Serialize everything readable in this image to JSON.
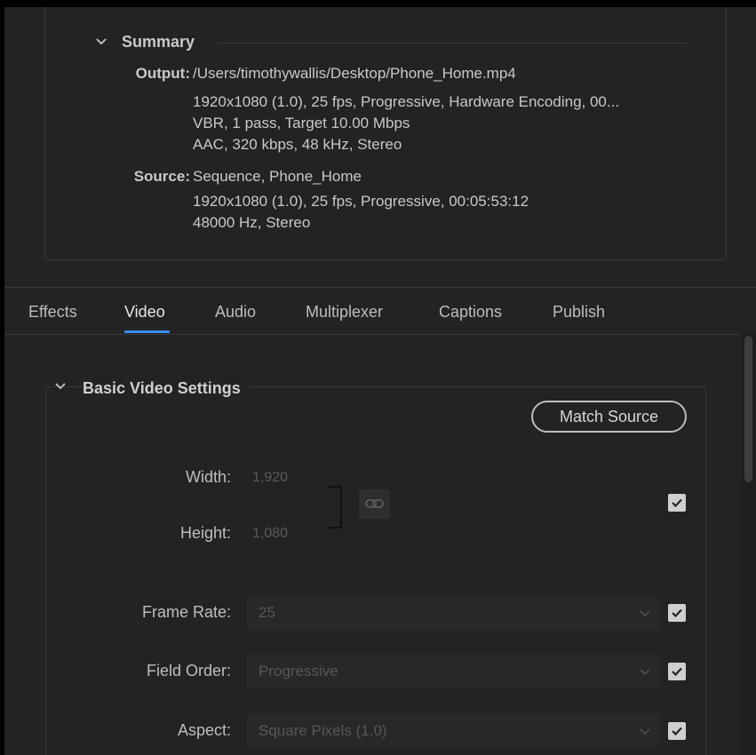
{
  "summary": {
    "title": "Summary",
    "output_label": "Output:",
    "output_lines": [
      "/Users/timothywallis/Desktop/Phone_Home.mp4",
      "1920x1080 (1.0), 25 fps, Progressive, Hardware Encoding, 00...",
      "VBR, 1 pass, Target 10.00 Mbps",
      "AAC, 320 kbps, 48 kHz, Stereo"
    ],
    "source_label": "Source:",
    "source_lines": [
      "Sequence, Phone_Home",
      "1920x1080 (1.0), 25 fps, Progressive, 00:05:53:12",
      "48000 Hz, Stereo"
    ]
  },
  "tabs": [
    {
      "label": "Effects",
      "active": false
    },
    {
      "label": "Video",
      "active": true
    },
    {
      "label": "Audio",
      "active": false
    },
    {
      "label": "Multiplexer",
      "active": false
    },
    {
      "label": "Captions",
      "active": false
    },
    {
      "label": "Publish",
      "active": false
    }
  ],
  "basic_video": {
    "title": "Basic Video Settings",
    "match_source_label": "Match Source",
    "width_label": "Width:",
    "width_value": "1,920",
    "height_label": "Height:",
    "height_value": "1,080",
    "dimensions_checked": true,
    "frame_rate_label": "Frame Rate:",
    "frame_rate_value": "25",
    "frame_rate_checked": true,
    "field_order_label": "Field Order:",
    "field_order_value": "Progressive",
    "field_order_checked": true,
    "aspect_label": "Aspect:",
    "aspect_value": "Square Pixels (1.0)",
    "aspect_checked": true
  },
  "icons": {
    "summary_toggle": "chevron-down-icon",
    "basic_video_toggle": "chevron-down-icon",
    "link": "chain-link-icon",
    "check": "checkmark-icon",
    "dropdown": "chevron-down-icon"
  },
  "colors": {
    "panel_bg": "#232323",
    "accent": "#378ef0",
    "text": "#c9c9c9",
    "disabled_text": "#575757"
  }
}
